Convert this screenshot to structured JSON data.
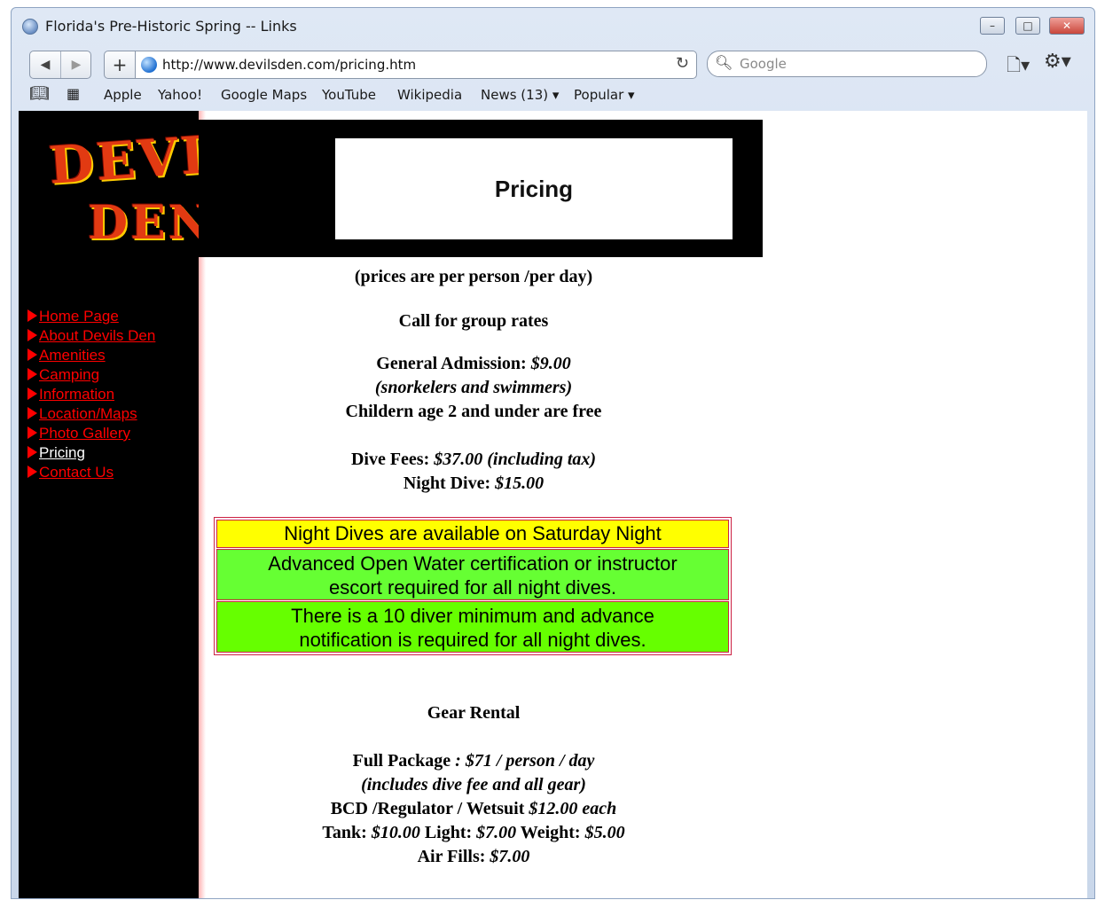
{
  "window": {
    "title": "Florida's Pre-Historic Spring -- Links",
    "controls": {
      "minimize": "–",
      "maximize": "□",
      "close": "✕"
    }
  },
  "toolbar": {
    "back": "◀",
    "forward": "▶",
    "add": "+",
    "url": "http://www.devilsden.com/pricing.htm",
    "search_placeholder": "Google"
  },
  "bookmarks": [
    "Apple",
    "Yahoo!",
    "Google Maps",
    "YouTube",
    "Wikipedia",
    "News (13) ▾",
    "Popular ▾"
  ],
  "site": {
    "logo_line1": "DEVIL'S",
    "logo_line2": "DEN",
    "page_title": "Pricing",
    "nav": [
      {
        "label": "Home Page"
      },
      {
        "label": "About Devils Den"
      },
      {
        "label": "Amenities"
      },
      {
        "label": "Camping"
      },
      {
        "label": "Information"
      },
      {
        "label": "Location/Maps"
      },
      {
        "label": "Photo Gallery"
      },
      {
        "label": "Pricing",
        "current": true
      },
      {
        "label": "Contact Us"
      }
    ]
  },
  "pricing": {
    "per_person": "(prices are per person /per day)",
    "group_rates": "Call for group rates",
    "general_label": "General Admission: ",
    "general_price": "$9.00",
    "general_note": "(snorkelers and swimmers)",
    "children": "Childern age 2 and under are free",
    "dive_label": "Dive Fees: ",
    "dive_price": "$37.00 (including tax)",
    "night_label": "Night Dive: ",
    "night_price": "$15.00"
  },
  "notices": {
    "saturday": "Night Dives are available on Saturday Night",
    "certification_line1": "Advanced Open Water certification or instructor",
    "certification_line2": "escort required for all night dives.",
    "minimum_line1": "There is a 10 diver minimum and advance",
    "minimum_line2": "notification is required for all night dives."
  },
  "gear": {
    "heading": "Gear Rental",
    "full_label": "Full Package",
    "full_price": " : $71 / person / day",
    "full_note": "(includes dive fee and all gear)",
    "bcd_label": "BCD /Regulator / Wetsuit ",
    "bcd_price": "$12.00 each",
    "tank_label": "Tank: ",
    "tank_price": "$10.00",
    "light_label": " Light: ",
    "light_price": "$7.00",
    "weight_label": " Weight: ",
    "weight_price": "$5.00",
    "air_label": "Air Fills: ",
    "air_price": "$7.00"
  }
}
